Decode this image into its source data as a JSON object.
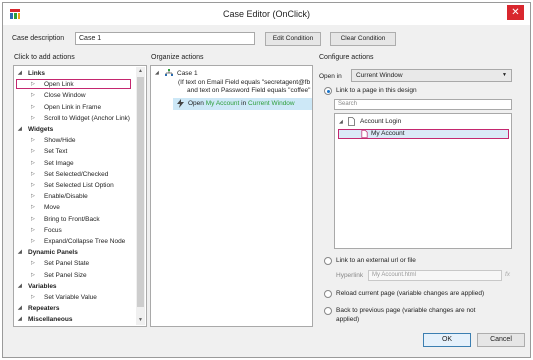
{
  "window": {
    "title": "Case Editor (OnClick)",
    "close_glyph": "✕"
  },
  "case": {
    "label": "Case description",
    "value": "Case 1",
    "edit_condition": "Edit Condition",
    "clear_condition": "Clear Condition"
  },
  "sections": {
    "actions": "Click to add actions",
    "organize": "Organize actions",
    "configure": "Configure actions"
  },
  "actions_tree": [
    {
      "label": "Links",
      "group": true
    },
    {
      "label": "Open Link",
      "group": false
    },
    {
      "label": "Close Window",
      "group": false
    },
    {
      "label": "Open Link in Frame",
      "group": false
    },
    {
      "label": "Scroll to Widget (Anchor Link)",
      "group": false
    },
    {
      "label": "Widgets",
      "group": true
    },
    {
      "label": "Show/Hide",
      "group": false
    },
    {
      "label": "Set Text",
      "group": false
    },
    {
      "label": "Set Image",
      "group": false
    },
    {
      "label": "Set Selected/Checked",
      "group": false
    },
    {
      "label": "Set Selected List Option",
      "group": false
    },
    {
      "label": "Enable/Disable",
      "group": false
    },
    {
      "label": "Move",
      "group": false
    },
    {
      "label": "Bring to Front/Back",
      "group": false
    },
    {
      "label": "Focus",
      "group": false
    },
    {
      "label": "Expand/Collapse Tree Node",
      "group": false
    },
    {
      "label": "Dynamic Panels",
      "group": true
    },
    {
      "label": "Set Panel State",
      "group": false
    },
    {
      "label": "Set Panel Size",
      "group": false
    },
    {
      "label": "Variables",
      "group": true
    },
    {
      "label": "Set Variable Value",
      "group": false
    },
    {
      "label": "Repeaters",
      "group": true
    },
    {
      "label": "Miscellaneous",
      "group": true
    }
  ],
  "organize": {
    "case_name": "Case 1",
    "condition_line1": "(If text on Email Field equals \"secretagent@fb",
    "condition_line2": "and text on Password Field equals \"coffee\"",
    "action_prefix": "Open",
    "action_target": "My Account",
    "action_in": "in",
    "action_window": "Current Window"
  },
  "configure": {
    "open_in_label": "Open in",
    "open_in_value": "Current Window",
    "link_page_label": "Link to a page in this design",
    "search_placeholder": "Search",
    "pages": [
      {
        "label": "Account Login"
      },
      {
        "label": "My Account"
      }
    ],
    "external_label": "Link to an external url or file",
    "hyperlink_label": "Hyperlink",
    "hyperlink_value": "My Account.html",
    "fx_label": "fx",
    "reload_label": "Reload current page (variable changes are applied)",
    "back_label_1": "Back to previous page (variable changes are not",
    "back_label_2": "applied)"
  },
  "footer": {
    "ok": "OK",
    "cancel": "Cancel"
  },
  "colors": {
    "selection_outline": "#c4276f",
    "green_text": "#2e9e3a",
    "close_red": "#d9272e",
    "highlight": "#cde8f7"
  }
}
